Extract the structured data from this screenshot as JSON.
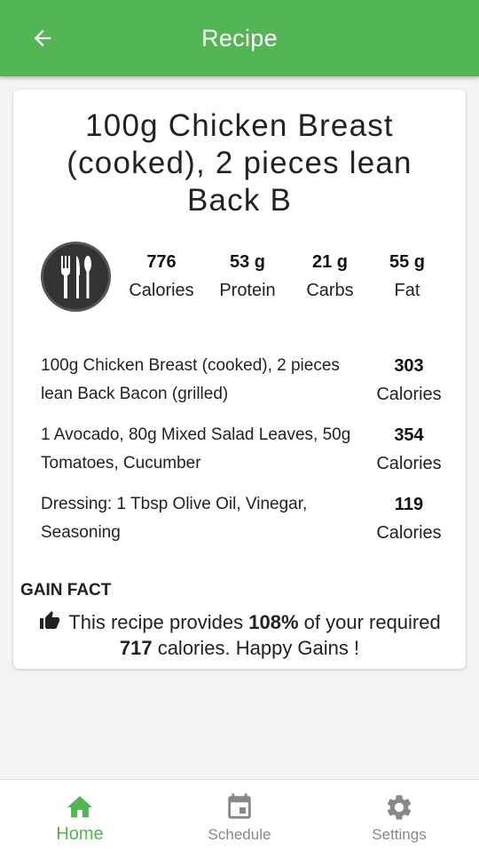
{
  "appbar": {
    "title": "Recipe",
    "back_icon": "arrow-left-icon"
  },
  "recipe": {
    "title": "100g Chicken Breast (cooked), 2 pieces lean Back B",
    "stats": [
      {
        "value": "776",
        "label": "Calories"
      },
      {
        "value": "53 g",
        "label": "Protein"
      },
      {
        "value": "21 g",
        "label": "Carbs"
      },
      {
        "value": "55 g",
        "label": "Fat"
      }
    ],
    "items": [
      {
        "desc": "100g Chicken Breast (cooked), 2 pieces lean Back Bacon (grilled)",
        "calories": "303",
        "unit": "Calories"
      },
      {
        "desc": "1 Avocado, 80g Mixed Salad Leaves, 50g Tomatoes, Cucumber",
        "calories": "354",
        "unit": "Calories"
      },
      {
        "desc": "Dressing: 1 Tbsp Olive Oil, Vinegar, Seasoning",
        "calories": "119",
        "unit": "Calories"
      }
    ]
  },
  "gain_fact": {
    "title": "GAIN FACT",
    "text_before": "This recipe provides ",
    "percent": "108%",
    "text_middle": " of your required ",
    "required": "717",
    "text_after": " calories. Happy Gains !"
  },
  "bottom_nav": [
    {
      "label": "Home",
      "icon": "home-icon",
      "active": true
    },
    {
      "label": "Schedule",
      "icon": "calendar-icon",
      "active": false
    },
    {
      "label": "Settings",
      "icon": "gear-icon",
      "active": false
    }
  ],
  "colors": {
    "primary": "#53b553",
    "inactive": "#888888"
  }
}
